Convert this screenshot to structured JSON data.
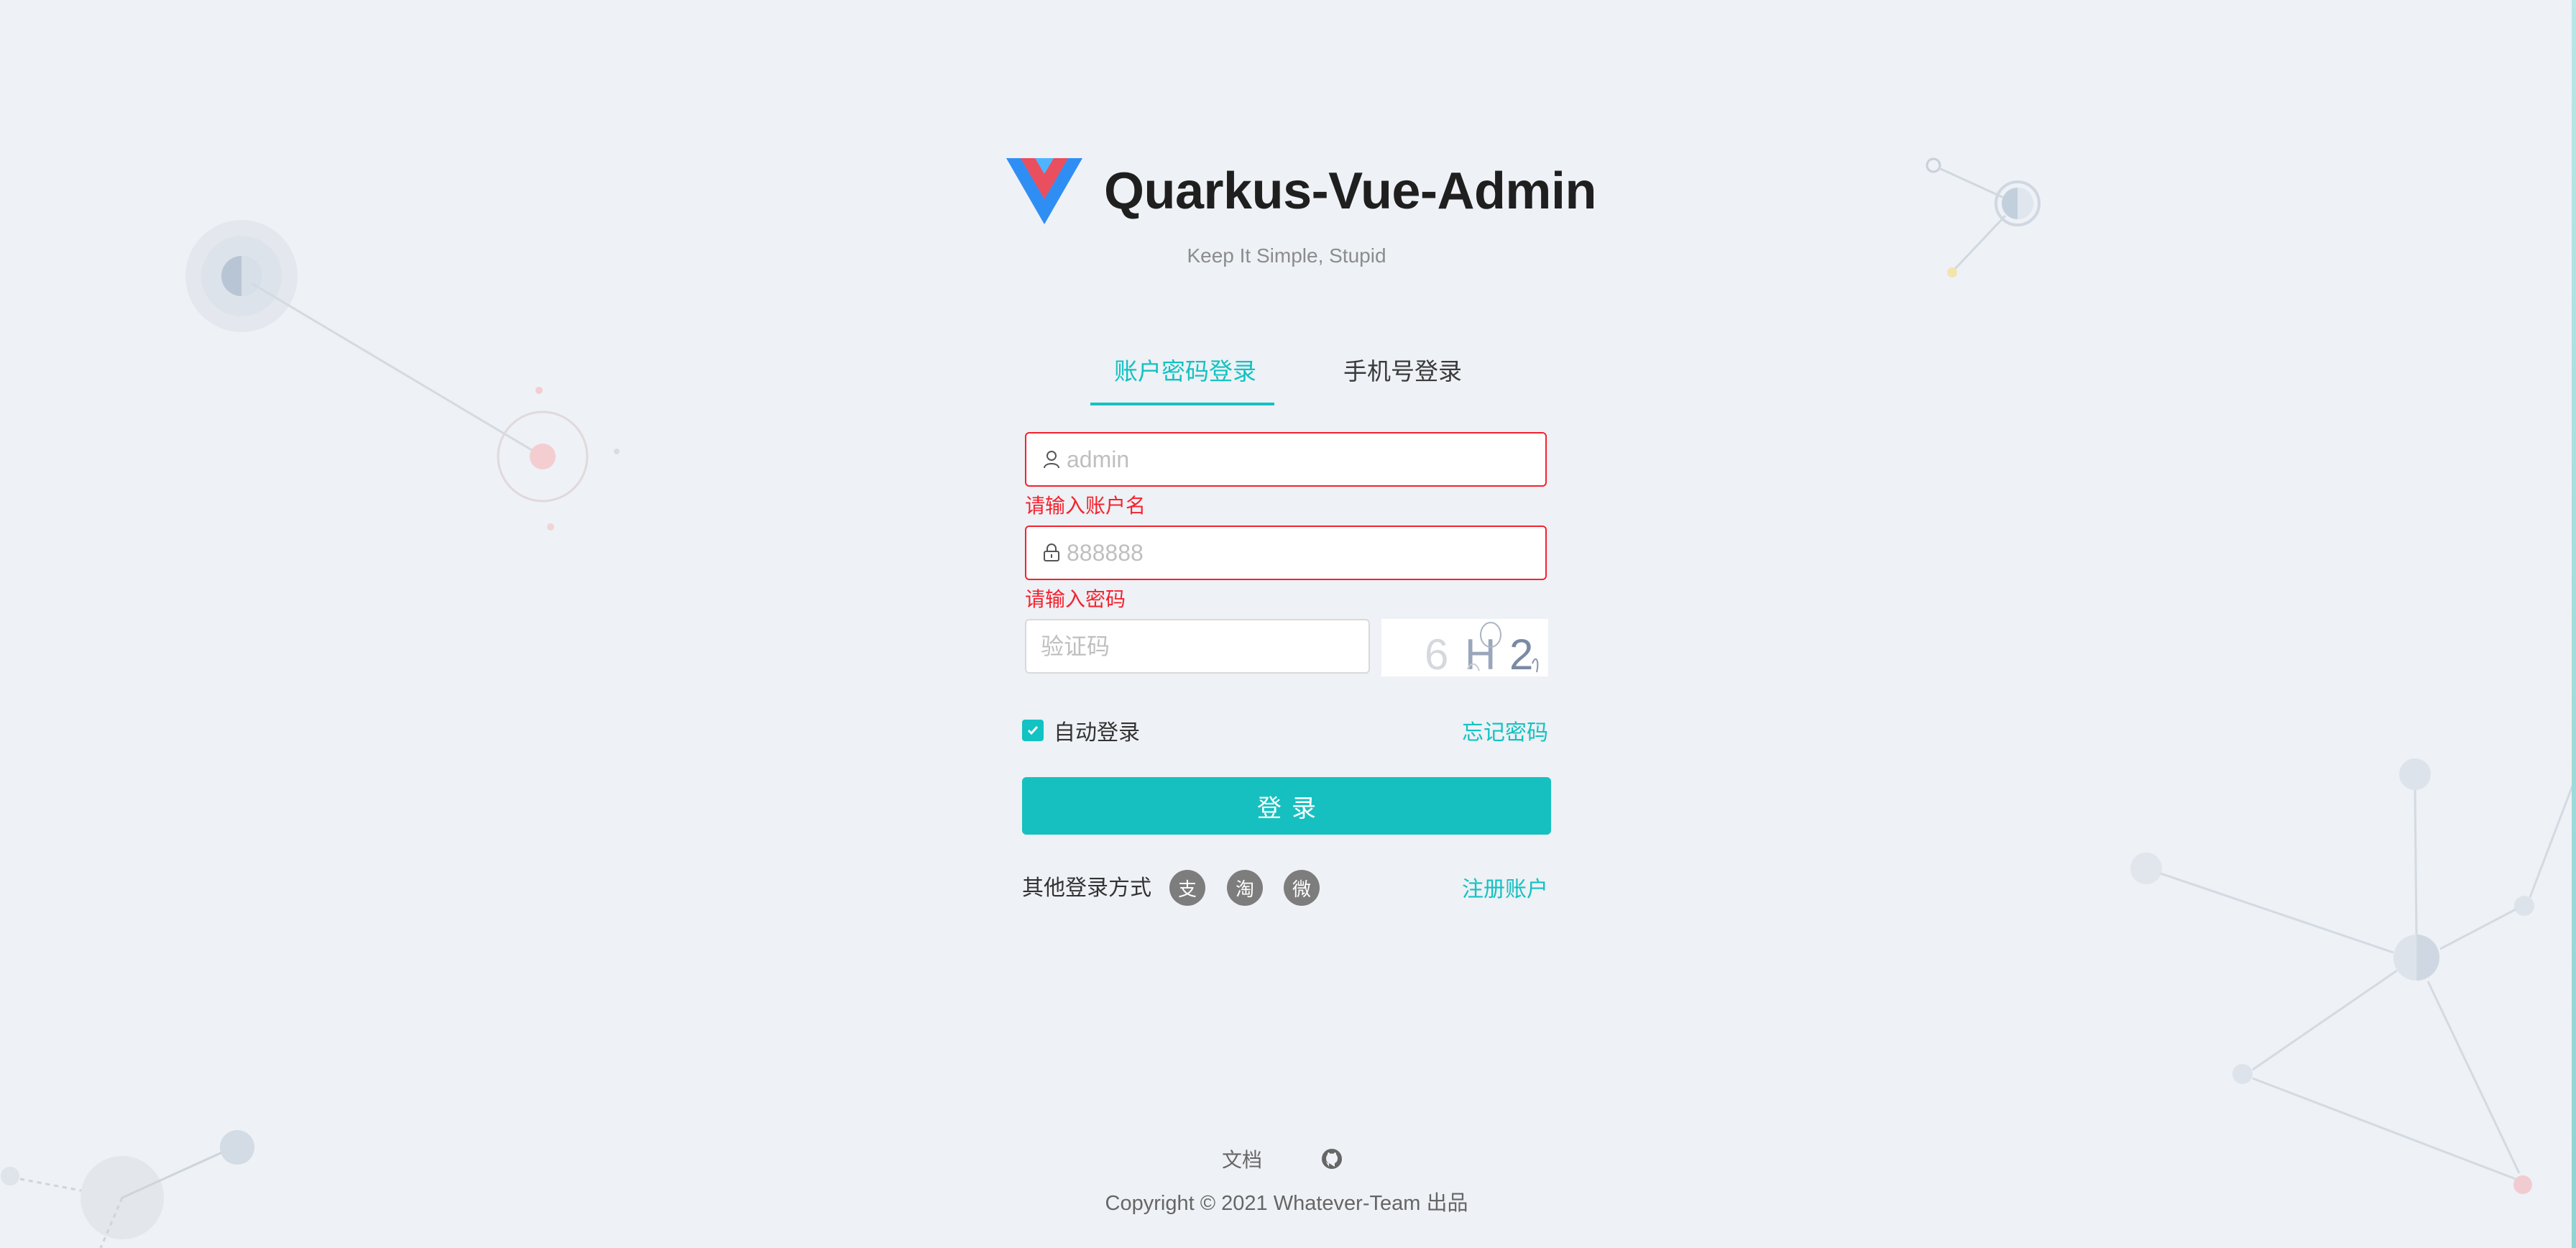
{
  "brand": {
    "title": "Quarkus-Vue-Admin",
    "subtitle": "Keep It Simple, Stupid",
    "logo_icon": "vue-logo-icon"
  },
  "tabs": [
    {
      "label": "账户密码登录",
      "active": true
    },
    {
      "label": "手机号登录",
      "active": false
    }
  ],
  "form": {
    "username": {
      "placeholder": "admin",
      "value": "",
      "icon": "user-icon",
      "error": "请输入账户名"
    },
    "password": {
      "placeholder": "888888",
      "value": "",
      "icon": "lock-icon",
      "error": "请输入密码"
    },
    "captcha": {
      "placeholder": "验证码",
      "value": "",
      "image_text": "6H2"
    },
    "remember": {
      "label": "自动登录",
      "checked": true
    },
    "forgot_label": "忘记密码",
    "submit_label": "登录"
  },
  "other_login": {
    "label": "其他登录方式",
    "providers": [
      {
        "name": "alipay",
        "icon": "alipay-icon",
        "glyph": "支"
      },
      {
        "name": "taobao",
        "icon": "taobao-icon",
        "glyph": "淘"
      },
      {
        "name": "weibo",
        "icon": "weibo-icon",
        "glyph": "微"
      }
    ],
    "register_label": "注册账户"
  },
  "footer": {
    "doc_label": "文档",
    "github_icon": "github-icon",
    "copyright_prefix": "Copyright",
    "copyright_text": "2021 Whatever-Team 出品"
  },
  "colors": {
    "primary": "#13c2c2",
    "error": "#f5222d",
    "background": "#eef1f5"
  }
}
